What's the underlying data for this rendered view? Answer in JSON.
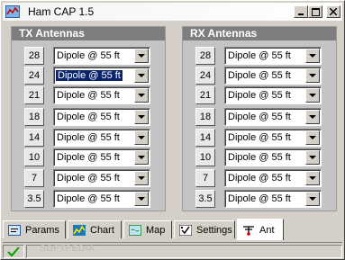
{
  "window": {
    "title": "Ham CAP 1.5"
  },
  "tx_panel": {
    "title": "TX Antennas",
    "rows": [
      {
        "band": "28",
        "antenna": "Dipole @ 55 ft"
      },
      {
        "band": "24",
        "antenna": "Dipole @ 55 ft"
      },
      {
        "band": "21",
        "antenna": "Dipole @ 55 ft"
      },
      {
        "band": "18",
        "antenna": "Dipole @ 55 ft"
      },
      {
        "band": "14",
        "antenna": "Dipole @ 55 ft"
      },
      {
        "band": "10",
        "antenna": "Dipole @ 55 ft"
      },
      {
        "band": "7",
        "antenna": "Dipole @ 55 ft"
      },
      {
        "band": "3.5",
        "antenna": "Dipole @ 55 ft"
      }
    ]
  },
  "rx_panel": {
    "title": "RX Antennas",
    "rows": [
      {
        "band": "28",
        "antenna": "Dipole @ 55 ft"
      },
      {
        "band": "24",
        "antenna": "Dipole @ 55 ft"
      },
      {
        "band": "21",
        "antenna": "Dipole @ 55 ft"
      },
      {
        "band": "18",
        "antenna": "Dipole @ 55 ft"
      },
      {
        "band": "14",
        "antenna": "Dipole @ 55 ft"
      },
      {
        "band": "10",
        "antenna": "Dipole @ 55 ft"
      },
      {
        "band": "7",
        "antenna": "Dipole @ 55 ft"
      },
      {
        "band": "3.5",
        "antenna": "Dipole @ 55 ft"
      }
    ]
  },
  "tabs": [
    {
      "label": "Params",
      "icon": "params-icon"
    },
    {
      "label": "Chart",
      "icon": "chart-icon"
    },
    {
      "label": "Map",
      "icon": "map-icon"
    },
    {
      "label": "Settings",
      "icon": "settings-icon"
    },
    {
      "label": "Ant",
      "icon": "antenna-icon",
      "active": true
    }
  ],
  "status": {
    "icon": "checkmark-icon",
    "watermark": "SOFTPEDIA"
  },
  "colors": {
    "panel_header": "#7e7e7e",
    "selection": "#0a246a",
    "face": "#d4d0c8"
  }
}
